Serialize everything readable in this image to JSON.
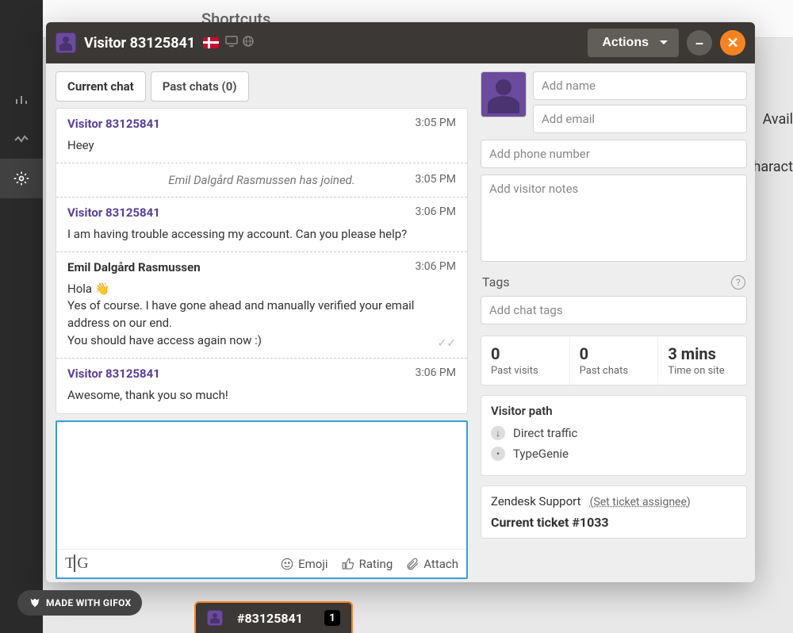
{
  "background": {
    "shortcuts_label": "Shortcuts",
    "avail_label_fragment": "Avail",
    "below_fragment": "haract"
  },
  "titlebar": {
    "visitor_title": "Visitor 83125841",
    "actions_label": "Actions"
  },
  "tabs": {
    "current": "Current chat",
    "past": "Past chats (0)"
  },
  "chat": [
    {
      "type": "visitor",
      "sender": "Visitor 83125841",
      "time": "3:05 PM",
      "body": "Heey"
    },
    {
      "type": "system",
      "text": "Emil Dalgård Rasmussen has joined.",
      "time": "3:05 PM"
    },
    {
      "type": "visitor",
      "sender": "Visitor 83125841",
      "time": "3:06 PM",
      "body": "I am having trouble accessing my account. Can you please help?"
    },
    {
      "type": "agent",
      "sender": "Emil Dalgård Rasmussen",
      "time": "3:06 PM",
      "lines": [
        "Hola 👋",
        "Yes of course. I have gone ahead and manually verified your email address on our end.",
        "You should have access again now :)"
      ],
      "read": true
    },
    {
      "type": "visitor",
      "sender": "Visitor 83125841",
      "time": "3:06 PM",
      "body": "Awesome, thank you so much!"
    }
  ],
  "composer": {
    "emoji_label": "Emoji",
    "rating_label": "Rating",
    "attach_label": "Attach"
  },
  "sidebar": {
    "add_name_placeholder": "Add name",
    "add_email_placeholder": "Add email",
    "add_phone_placeholder": "Add phone number",
    "add_notes_placeholder": "Add visitor notes",
    "tags_label": "Tags",
    "add_tags_placeholder": "Add chat tags",
    "stats": {
      "past_visits_value": "0",
      "past_visits_label": "Past visits",
      "past_chats_value": "0",
      "past_chats_label": "Past chats",
      "time_on_site_value": "3 mins",
      "time_on_site_label": "Time on site"
    },
    "visitor_path_label": "Visitor path",
    "path_items": [
      "Direct traffic",
      "TypeGenie"
    ],
    "zendesk_label": "Zendesk Support",
    "assignee_label": "(Set ticket assignee)",
    "current_ticket_label": "Current ticket #1033"
  },
  "footer": {
    "gifox_label": "MADE WITH GIFOX",
    "bottom_tab_label": "#83125841",
    "bottom_tab_count": "1"
  }
}
